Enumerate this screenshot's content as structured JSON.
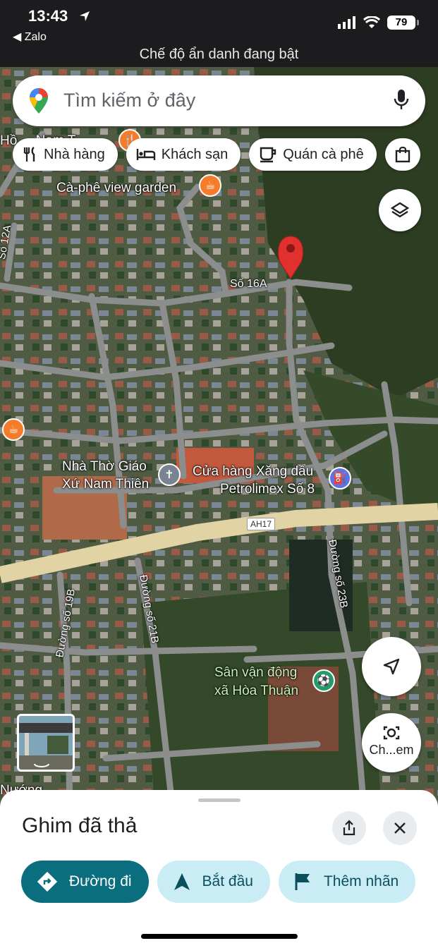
{
  "status_bar": {
    "time": "13:43",
    "back_app": "◀ Zalo",
    "battery": "79",
    "incognito_notice": "Chế độ ẩn danh đang bật"
  },
  "search": {
    "placeholder": "Tìm kiếm ở đây"
  },
  "chips": [
    {
      "label": "Nhà hàng",
      "icon": "restaurant-icon"
    },
    {
      "label": "Khách sạn",
      "icon": "hotel-icon"
    },
    {
      "label": "Quán cà phê",
      "icon": "coffee-icon"
    }
  ],
  "map": {
    "labels": {
      "top_left_partial": "Hồ ... Nam T...",
      "cafe": "Cà-phê view garden",
      "dropped_pin": "Số 16A",
      "church_line1": "Nhà Thờ Giáo",
      "church_line2": "Xứ Nam Thiên",
      "gas_line1": "Cửa hàng Xăng dầu",
      "gas_line2": "Petrolimex Số 8",
      "stadium_line1": "Sân vận động",
      "stadium_line2": "xã Hòa Thuận",
      "bottom_left_partial": "Nướng"
    },
    "roads": {
      "highway": "AH17",
      "road_12a": "Số 12A",
      "road_19b": "Đường số 19B",
      "road_21b": "Đường số 21B",
      "road_23b": "Đường số 23B"
    },
    "lens_button": "Ch...em"
  },
  "sheet": {
    "title": "Ghim đã thả",
    "actions": [
      {
        "label": "Đường đi"
      },
      {
        "label": "Bắt đầu"
      },
      {
        "label": "Thêm nhãn"
      }
    ]
  }
}
